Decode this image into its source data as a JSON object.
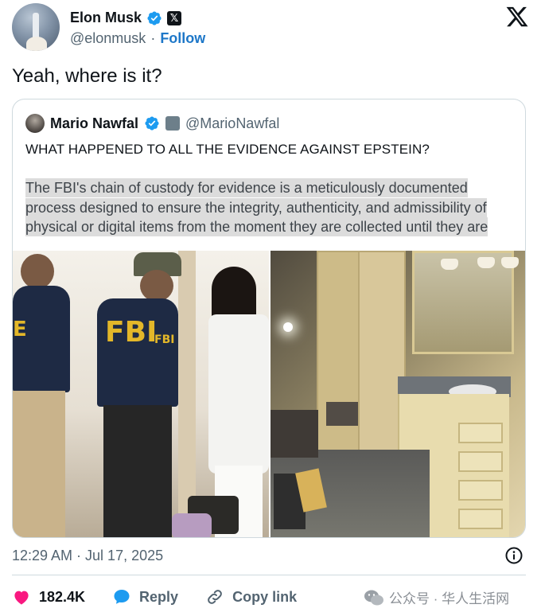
{
  "author": {
    "name": "Elon Musk",
    "handle": "@elonmusk",
    "separator": "·",
    "follow_label": "Follow"
  },
  "tweet": {
    "text": "Yeah, where is it?"
  },
  "quoted": {
    "name": "Mario Nawfal",
    "handle": "@MarioNawfal",
    "title": "WHAT HAPPENED TO ALL THE EVIDENCE AGAINST EPSTEIN?",
    "body_lines": [
      "The FBI's chain of custody for evidence is a meticulously documented",
      "process designed to ensure the integrity, authenticity, and admissibility of",
      "physical or digital items from the moment they are collected until they are"
    ],
    "photo_left_text": "FBI",
    "photo_left_text2": "FBI"
  },
  "meta": {
    "timestamp": "12:29 AM · Jul 17, 2025"
  },
  "actions": {
    "likes": "182.4K",
    "reply_label": "Reply",
    "copy_link_label": "Copy link"
  },
  "watermark": {
    "text": "公众号 · 华人生活网"
  },
  "colors": {
    "verified": "#1d9bf0",
    "follow": "#1d77c8",
    "heart": "#f91880",
    "reply_bubble": "#1d9bf0",
    "muted": "#536471"
  },
  "icons": {
    "verified": "verified-badge-icon",
    "x_logo": "x-logo-icon",
    "info": "info-icon",
    "heart": "heart-icon",
    "reply": "speech-bubble-icon",
    "link": "link-icon",
    "wechat": "wechat-icon"
  }
}
